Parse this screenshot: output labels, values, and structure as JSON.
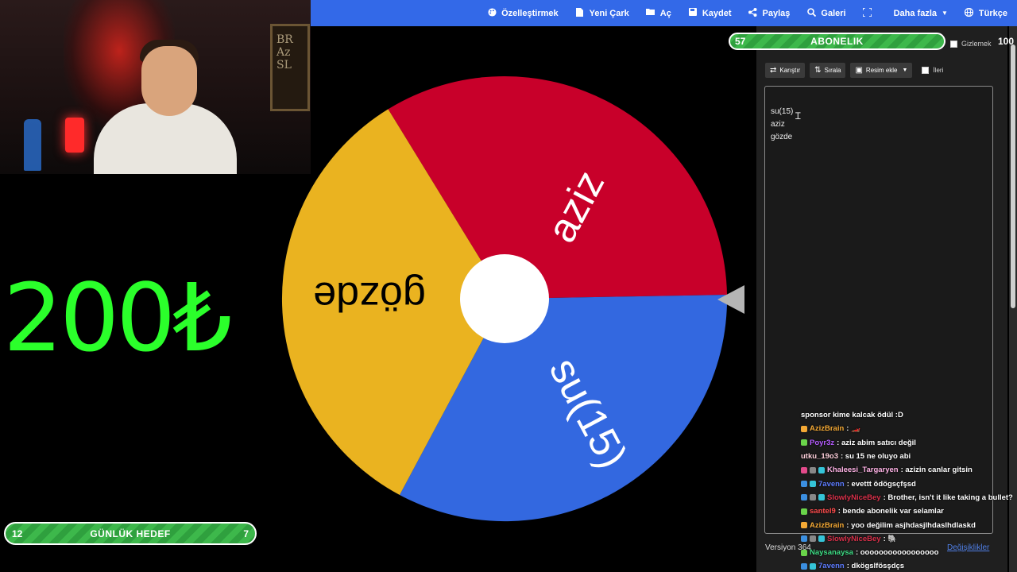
{
  "nav": {
    "customize": "Özelleştirmek",
    "new_wheel": "Yeni Çark",
    "open": "Aç",
    "save": "Kaydet",
    "share": "Paylaş",
    "gallery": "Galeri",
    "more": "Daha fazla",
    "language": "Türkçe",
    "icons": {
      "customize": "palette-icon",
      "new_wheel": "file-icon",
      "open": "folder-open-icon",
      "save": "save-icon",
      "share": "share-icon",
      "gallery": "search-icon",
      "fullscreen": "fullscreen-icon",
      "language": "globe-icon"
    },
    "color": "#3369e8"
  },
  "subscription_goal": {
    "current": "57",
    "title": "ABONELIK",
    "target": "100",
    "hide_label": "Gizlemek"
  },
  "toolbar": {
    "shuffle": "Karıştır",
    "sort": "Sırala",
    "add_image": "Resim ekle",
    "advanced": "İleri"
  },
  "entries": [
    "su(15)",
    "aziz",
    "gözde"
  ],
  "wheel": {
    "segments": [
      {
        "label": "aziz",
        "color": "#c8002a"
      },
      {
        "label": "su(15)",
        "color": "#3368e0"
      },
      {
        "label": "gözde",
        "color": "#eab320"
      }
    ]
  },
  "footer": {
    "version": "Versiyon 364",
    "changes": "Değişiklikler"
  },
  "overlay": {
    "amount": "200₺",
    "daily_goal": {
      "current": "12",
      "title": "GÜNLÜK HEDEF",
      "target": "7"
    }
  },
  "webcam": {
    "shelf_text": "BR\nAz\nSL"
  },
  "chat": [
    {
      "user": "",
      "text": "sponsor kime kalcak ödül :D",
      "color": "#ffffff",
      "badges": []
    },
    {
      "user": "AzizBrain",
      "text": ": 🏎️",
      "color": "#f4a935",
      "badges": [
        "#f4a935"
      ]
    },
    {
      "user": "Poyr3z",
      "text": ": aziz abim satıcı değil",
      "color": "#b55cff",
      "badges": [
        "#6ad44a"
      ]
    },
    {
      "user": "utku_19o3",
      "text": ": su 15 ne oluyo abi",
      "color": "#ffd1dc",
      "badges": []
    },
    {
      "user": "Khaleesi_Targaryen",
      "text": ": azizin canlar gitsin",
      "color": "#ffb3e6",
      "badges": [
        "#e24a8a",
        "#888888",
        "#35c4d8"
      ]
    },
    {
      "user": "7avenn",
      "text": ": evettt ödögsçfşsd",
      "color": "#5d7cff",
      "badges": [
        "#3b8fe0",
        "#35c4d8"
      ]
    },
    {
      "user": "SlowlyNiceBey",
      "text": ": Brother, isn't it like taking a bullet?",
      "color": "#d9304a",
      "badges": [
        "#3b8fe0",
        "#888888",
        "#35c4d8"
      ]
    },
    {
      "user": "santel9",
      "text": ": bende abonelik var selamlar",
      "color": "#ff4d4d",
      "badges": [
        "#6ad44a"
      ]
    },
    {
      "user": "AzizBrain",
      "text": ": yoo değilim asjhdasjlhdaslhdlaskd",
      "color": "#f4a935",
      "badges": [
        "#f4a935"
      ]
    },
    {
      "user": "SlowlyNiceBey",
      "text": ": 🐘",
      "color": "#d9304a",
      "badges": [
        "#3b8fe0",
        "#888888",
        "#35c4d8"
      ]
    },
    {
      "user": "Naysanaysa",
      "text": ": ooooooooooooooooo",
      "color": "#3ddc84",
      "badges": [
        "#6ad44a"
      ]
    },
    {
      "user": "7avenn",
      "text": ": dkögslfösşdçs",
      "color": "#5d7cff",
      "badges": [
        "#3b8fe0",
        "#35c4d8"
      ]
    }
  ]
}
